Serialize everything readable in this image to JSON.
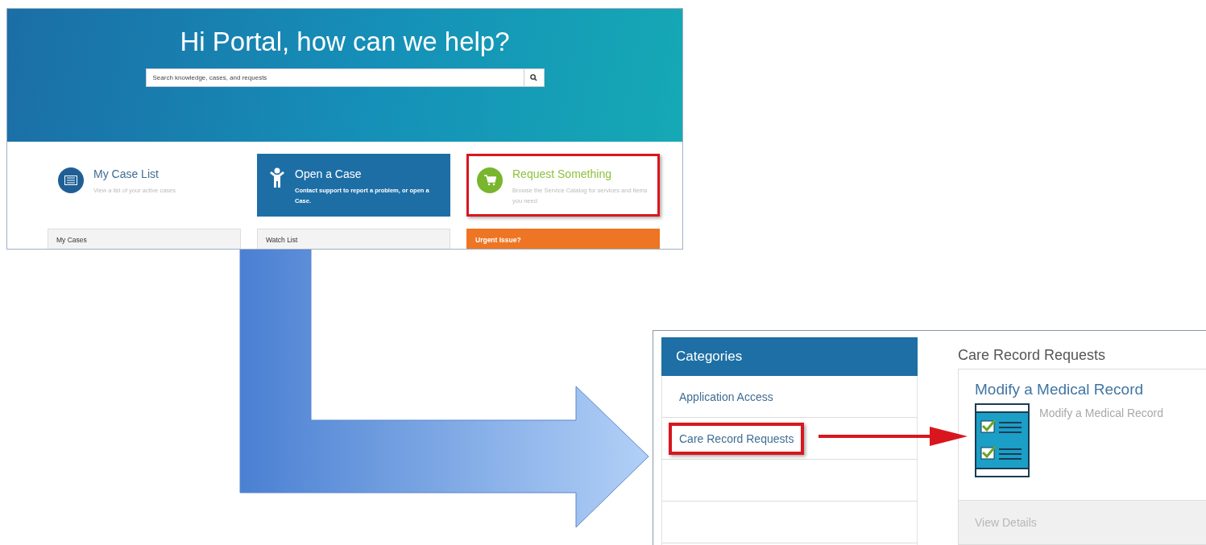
{
  "portal_screen": {
    "greeting": "Hi Portal, how can we help?",
    "search": {
      "placeholder": "Search knowledge, cases, and requests"
    },
    "actions": [
      {
        "kind": "list",
        "title": "My Case List",
        "description": "View a list of your active cases",
        "highlighted": false
      },
      {
        "kind": "tile",
        "title": "Open a Case",
        "description": "Contact support to report a problem, or open a Case.",
        "highlighted": false
      },
      {
        "kind": "cart",
        "title": "Request Something",
        "description": "Browse the Service Catalog for services and items you need",
        "highlighted": true
      }
    ],
    "panels": [
      {
        "kind": "plain",
        "title": "My Cases"
      },
      {
        "kind": "plain",
        "title": "Watch List"
      },
      {
        "kind": "alert",
        "title": "Urgent Issue?"
      }
    ]
  },
  "catalog_screen": {
    "categories_title": "Categories",
    "categories": [
      {
        "label": "Application Access",
        "highlighted": false
      },
      {
        "label": "Care Record Requests",
        "highlighted": true
      }
    ],
    "section_title": "Care Record Requests",
    "item": {
      "title": "Modify a Medical Record",
      "description": "Modify a Medical Record",
      "link": "View Details"
    }
  }
}
